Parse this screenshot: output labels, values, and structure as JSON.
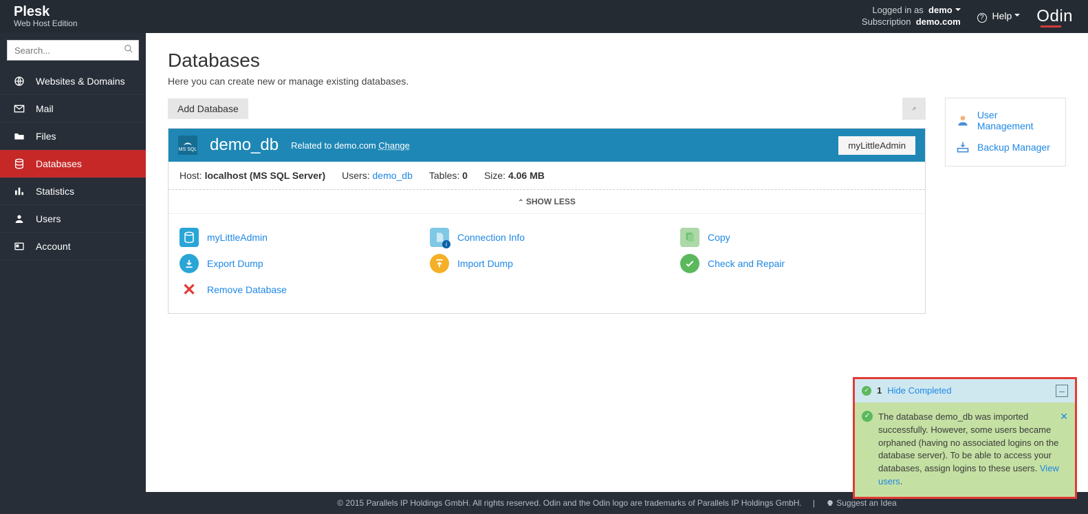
{
  "brand": {
    "name": "Plesk",
    "edition": "Web Host Edition"
  },
  "top": {
    "logged_in_as_label": "Logged in as",
    "user": "demo",
    "subscription_label": "Subscription",
    "subscription": "demo.com",
    "help": "Help",
    "odin": "Odin"
  },
  "search": {
    "placeholder": "Search..."
  },
  "nav": {
    "items": [
      {
        "label": "Websites & Domains"
      },
      {
        "label": "Mail"
      },
      {
        "label": "Files"
      },
      {
        "label": "Databases"
      },
      {
        "label": "Statistics"
      },
      {
        "label": "Users"
      },
      {
        "label": "Account"
      }
    ]
  },
  "page": {
    "title": "Databases",
    "subtitle": "Here you can create new or manage existing databases.",
    "add_button": "Add Database"
  },
  "db": {
    "engine_badge": "MS SQL",
    "name": "demo_db",
    "related_label": "Related to",
    "domain": "demo.com",
    "change": "Change",
    "top_button": "myLittleAdmin",
    "meta": {
      "host_label": "Host:",
      "host_value": "localhost (MS SQL Server)",
      "users_label": "Users:",
      "users_value": "demo_db",
      "tables_label": "Tables:",
      "tables_value": "0",
      "size_label": "Size:",
      "size_value": "4.06 MB"
    },
    "showless": "SHOW LESS",
    "actions": {
      "mylittleadmin": "myLittleAdmin",
      "connection_info": "Connection Info",
      "copy": "Copy",
      "export_dump": "Export Dump",
      "import_dump": "Import Dump",
      "check_repair": "Check and Repair",
      "remove": "Remove Database"
    }
  },
  "sidepanel": {
    "user_management": "User Management",
    "backup_manager": "Backup Manager"
  },
  "notif": {
    "count": "1",
    "hide_label": "Hide Completed",
    "message": "The database demo_db was imported successfully. However, some users became orphaned (having no associated logins on the database server). To be able to access your databases, assign logins to these users. ",
    "view_users": "View users"
  },
  "footer": {
    "copyright": "© 2015 Parallels IP Holdings GmbH. All rights reserved. Odin and the Odin logo are trademarks of Parallels IP Holdings GmbH.",
    "suggest": "Suggest an Idea"
  }
}
